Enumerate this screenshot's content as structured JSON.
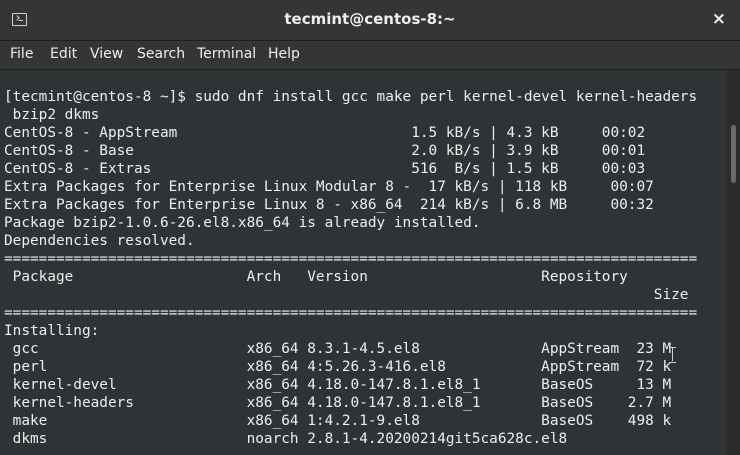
{
  "window": {
    "title": "tecmint@centos-8:~",
    "close_glyph": "×"
  },
  "menu": [
    "File",
    "Edit",
    "View",
    "Search",
    "Terminal",
    "Help"
  ],
  "terminal": {
    "lines": [
      "",
      "[tecmint@centos-8 ~]$ sudo dnf install gcc make perl kernel-devel kernel-headers",
      " bzip2 dkms",
      "CentOS-8 - AppStream                           1.5 kB/s | 4.3 kB     00:02",
      "CentOS-8 - Base                                2.0 kB/s | 3.9 kB     00:01",
      "CentOS-8 - Extras                              516  B/s | 1.5 kB     00:03",
      "Extra Packages for Enterprise Linux Modular 8 -  17 kB/s | 118 kB     00:07",
      "Extra Packages for Enterprise Linux 8 - x86_64  214 kB/s | 6.8 MB     00:32",
      "Package bzip2-1.0.6-26.el8.x86_64 is already installed.",
      "Dependencies resolved.",
      "================================================================================",
      " Package                    Arch   Version                    Repository",
      "                                                                           Size",
      "================================================================================",
      "Installing:",
      " gcc                        x86_64 8.3.1-4.5.el8              AppStream  23 M",
      " perl                       x86_64 4:5.26.3-416.el8           AppStream  72 k",
      " kernel-devel               x86_64 4.18.0-147.8.1.el8_1       BaseOS     13 M",
      " kernel-headers             x86_64 4.18.0-147.8.1.el8_1       BaseOS    2.7 M",
      " make                       x86_64 1:4.2.1-9.el8              BaseOS    498 k",
      " dkms                       noarch 2.8.1-4.20200214git5ca628c.el8",
      "                                                                    "
    ]
  }
}
